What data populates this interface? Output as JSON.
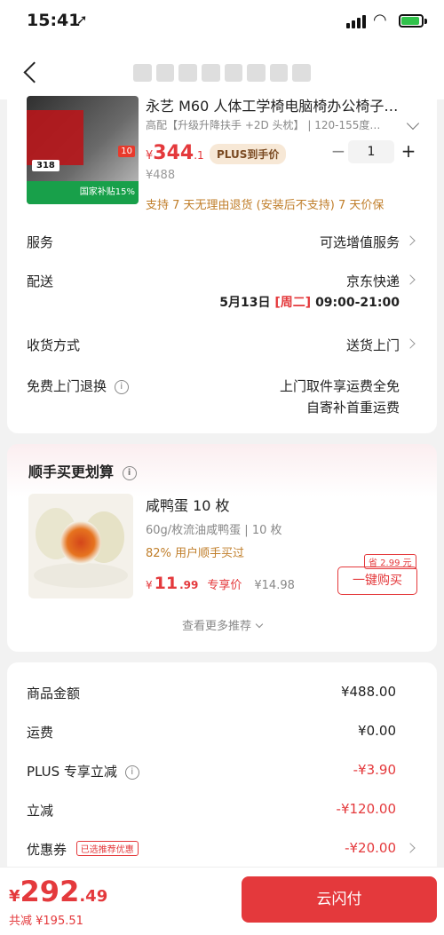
{
  "status_bar": {
    "time": "15:41",
    "location_arrow": "➚"
  },
  "product": {
    "title": "永艺 M60 人体工学椅电脑椅办公椅子…",
    "spec": "高配【升级升降扶手 +2D 头枕】 | 120-155度…",
    "price_symbol": "¥",
    "price_int": "344",
    "price_dec": ".1",
    "plus_badge": "PLUS到手价",
    "original_price": "¥488",
    "quantity": "1",
    "minus": "−",
    "plus": "+",
    "return_policy": "支持 7 天无理由退货 (安装后不支持)  7 天价保",
    "image_num": "318",
    "image_badge": "10",
    "image_tag": "国家补贴15%"
  },
  "rows": {
    "service_label": "服务",
    "service_value": "可选增值服务",
    "delivery_label": "配送",
    "delivery_value": "京东快递",
    "delivery_date": "5月13日",
    "delivery_weekday": "[周二]",
    "delivery_time": "09:00-21:00",
    "receive_label": "收货方式",
    "receive_value": "送货上门",
    "free_return_label": "免费上门退换",
    "free_return_value1": "上门取件享运费全免",
    "free_return_value2": "自寄补首重运费"
  },
  "recommend": {
    "title": "顺手买更划算",
    "name": "咸鸭蛋 10 枚",
    "spec": "60g/枚流油咸鸭蛋 | 10 枚",
    "users": "82% 用户顺手买过",
    "price_symbol": "¥",
    "price_int": "11",
    "price_dec": ".99",
    "price_label": "专享价",
    "old_price": "¥14.98",
    "save_tag": "省 2.99 元",
    "buy_button": "一键购买",
    "more": "查看更多推荐"
  },
  "summary": {
    "goods_label": "商品金额",
    "goods_value": "¥488.00",
    "shipping_label": "运费",
    "shipping_value": "¥0.00",
    "plus_label": "PLUS 专享立减",
    "plus_value": "-¥3.90",
    "discount_label": "立减",
    "discount_value": "-¥120.00",
    "coupon_label": "优惠券",
    "coupon_tag": "已选推荐优惠",
    "coupon_value": "-¥20.00"
  },
  "bottom": {
    "total_symbol": "¥",
    "total_int": "292",
    "total_dec": ".49",
    "total_discount": "共减 ¥195.51",
    "pay_button": "云闪付"
  },
  "colors": {
    "accent": "#e4393c",
    "orange": "#c07e2a"
  }
}
